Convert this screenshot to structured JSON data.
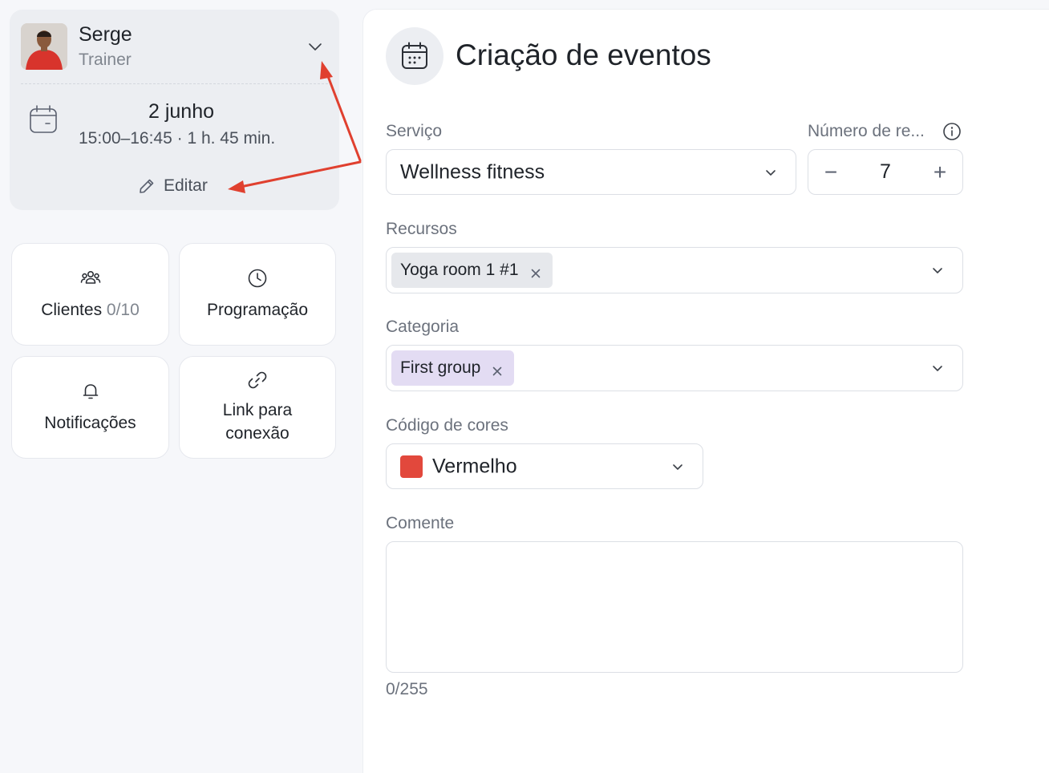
{
  "trainer": {
    "name": "Serge",
    "role": "Trainer"
  },
  "event": {
    "date": "2 junho",
    "time": "15:00–16:45 · 1 h. 45 min.",
    "edit_label": "Editar"
  },
  "tiles": {
    "clients_label": "Clientes",
    "clients_count": "0/10",
    "schedule_label": "Programação",
    "notifications_label": "Notificações",
    "link_label_line1": "Link para",
    "link_label_line2": "conexão"
  },
  "form": {
    "title": "Criação de eventos",
    "service_label": "Serviço",
    "service_value": "Wellness fitness",
    "count_label": "Número de re...",
    "count_value": "7",
    "minus_symbol": "−",
    "plus_symbol": "+",
    "resources_label": "Recursos",
    "resources_chip": "Yoga room 1 #1",
    "category_label": "Categoria",
    "category_chip": "First group",
    "color_label": "Código de cores",
    "color_value": "Vermelho",
    "color_hex": "#e2483c",
    "comment_label": "Comente",
    "comment_value": "",
    "char_count": "0/255"
  },
  "colors": {
    "accent_red": "#e2483c",
    "annotation_arrow": "#e0402f",
    "category_chip": "#e3dcf3"
  },
  "icons": {
    "trainer_menu": "chevron-down-icon",
    "date": "calendar-icon",
    "edit": "pencil-icon",
    "clients": "users-icon",
    "schedule": "clock-icon",
    "notifications": "bell-icon",
    "link": "link-icon",
    "header": "calendar-icon",
    "info": "info-icon",
    "chip_remove": "close-icon"
  }
}
